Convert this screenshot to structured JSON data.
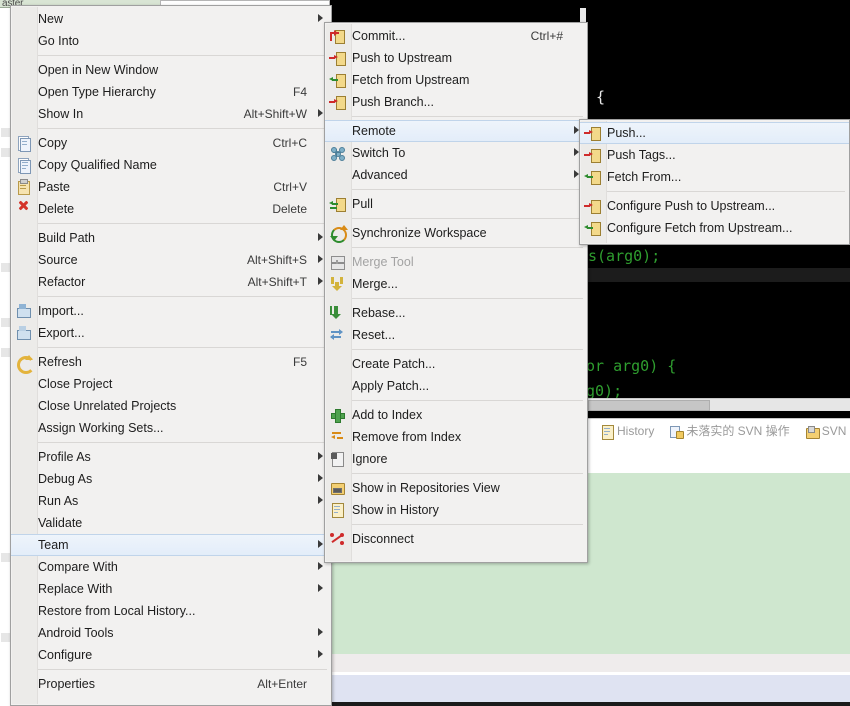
{
  "app": {
    "background_label": "aster",
    "editor_code_lines": [
      {
        "text": "{",
        "color": "white"
      },
      {
        "text": "s(arg0);",
        "color": "green"
      },
      {
        "text": "or arg0) {",
        "color": "mixed"
      },
      {
        "text": "g0);",
        "color": "green"
      }
    ],
    "view_tabs": [
      {
        "icon": "history-icon",
        "label": "History"
      },
      {
        "icon": "svn-pending-icon",
        "label": "未落实的 SVN 操作"
      },
      {
        "icon": "svn-resource-icon",
        "label": "SVN 资"
      }
    ]
  },
  "context_menu": {
    "name": "project-context-menu",
    "items": [
      {
        "label": "New",
        "icon": "",
        "accel": "",
        "submenu": true
      },
      {
        "label": "Go Into",
        "icon": "",
        "accel": "",
        "submenu": false
      },
      {
        "separator": true
      },
      {
        "label": "Open in New Window",
        "icon": "",
        "accel": "",
        "submenu": false
      },
      {
        "label": "Open Type Hierarchy",
        "icon": "",
        "accel": "F4",
        "submenu": false
      },
      {
        "label": "Show In",
        "icon": "",
        "accel": "Alt+Shift+W",
        "submenu": true
      },
      {
        "separator": true
      },
      {
        "label": "Copy",
        "icon": "copy-icon",
        "accel": "Ctrl+C",
        "submenu": false
      },
      {
        "label": "Copy Qualified Name",
        "icon": "copy-qualified-icon",
        "accel": "",
        "submenu": false
      },
      {
        "label": "Paste",
        "icon": "paste-icon",
        "accel": "Ctrl+V",
        "submenu": false
      },
      {
        "label": "Delete",
        "icon": "delete-icon",
        "accel": "Delete",
        "submenu": false
      },
      {
        "separator": true
      },
      {
        "label": "Build Path",
        "icon": "",
        "accel": "",
        "submenu": true
      },
      {
        "label": "Source",
        "icon": "",
        "accel": "Alt+Shift+S",
        "submenu": true
      },
      {
        "label": "Refactor",
        "icon": "",
        "accel": "Alt+Shift+T",
        "submenu": true
      },
      {
        "separator": true
      },
      {
        "label": "Import...",
        "icon": "import-icon",
        "accel": "",
        "submenu": false
      },
      {
        "label": "Export...",
        "icon": "export-icon",
        "accel": "",
        "submenu": false
      },
      {
        "separator": true
      },
      {
        "label": "Refresh",
        "icon": "refresh-icon",
        "accel": "F5",
        "submenu": false
      },
      {
        "label": "Close Project",
        "icon": "",
        "accel": "",
        "submenu": false
      },
      {
        "label": "Close Unrelated Projects",
        "icon": "",
        "accel": "",
        "submenu": false
      },
      {
        "label": "Assign Working Sets...",
        "icon": "",
        "accel": "",
        "submenu": false
      },
      {
        "separator": true
      },
      {
        "label": "Profile As",
        "icon": "",
        "accel": "",
        "submenu": true
      },
      {
        "label": "Debug As",
        "icon": "",
        "accel": "",
        "submenu": true
      },
      {
        "label": "Run As",
        "icon": "",
        "accel": "",
        "submenu": true
      },
      {
        "label": "Validate",
        "icon": "",
        "accel": "",
        "submenu": false
      },
      {
        "label": "Team",
        "icon": "",
        "accel": "",
        "submenu": true,
        "selected": true
      },
      {
        "label": "Compare With",
        "icon": "",
        "accel": "",
        "submenu": true
      },
      {
        "label": "Replace With",
        "icon": "",
        "accel": "",
        "submenu": true
      },
      {
        "label": "Restore from Local History...",
        "icon": "",
        "accel": "",
        "submenu": false
      },
      {
        "label": "Android Tools",
        "icon": "",
        "accel": "",
        "submenu": true
      },
      {
        "label": "Configure",
        "icon": "",
        "accel": "",
        "submenu": true
      },
      {
        "separator": true
      },
      {
        "label": "Properties",
        "icon": "",
        "accel": "Alt+Enter",
        "submenu": false
      }
    ]
  },
  "team_menu": {
    "name": "team-submenu",
    "items": [
      {
        "label": "Commit...",
        "icon": "commit-icon",
        "accel": "Ctrl+#",
        "submenu": false
      },
      {
        "label": "Push to Upstream",
        "icon": "push-upstream-icon",
        "accel": "",
        "submenu": false
      },
      {
        "label": "Fetch from Upstream",
        "icon": "fetch-upstream-icon",
        "accel": "",
        "submenu": false
      },
      {
        "label": "Push Branch...",
        "icon": "push-branch-icon",
        "accel": "",
        "submenu": false
      },
      {
        "separator": true
      },
      {
        "label": "Remote",
        "icon": "",
        "accel": "",
        "submenu": true,
        "selected": true
      },
      {
        "label": "Switch To",
        "icon": "switch-to-icon",
        "accel": "",
        "submenu": true
      },
      {
        "label": "Advanced",
        "icon": "",
        "accel": "",
        "submenu": true
      },
      {
        "separator": true
      },
      {
        "label": "Pull",
        "icon": "pull-icon",
        "accel": "",
        "submenu": false
      },
      {
        "separator": true
      },
      {
        "label": "Synchronize Workspace",
        "icon": "synchronize-icon",
        "accel": "",
        "submenu": false
      },
      {
        "separator": true
      },
      {
        "label": "Merge Tool",
        "icon": "merge-tool-icon",
        "accel": "",
        "submenu": false,
        "disabled": true
      },
      {
        "label": "Merge...",
        "icon": "merge-icon",
        "accel": "",
        "submenu": false
      },
      {
        "separator": true
      },
      {
        "label": "Rebase...",
        "icon": "rebase-icon",
        "accel": "",
        "submenu": false
      },
      {
        "label": "Reset...",
        "icon": "reset-icon",
        "accel": "",
        "submenu": false
      },
      {
        "separator": true
      },
      {
        "label": "Create Patch...",
        "icon": "",
        "accel": "",
        "submenu": false
      },
      {
        "label": "Apply Patch...",
        "icon": "",
        "accel": "",
        "submenu": false
      },
      {
        "separator": true
      },
      {
        "label": "Add to Index",
        "icon": "add-to-index-icon",
        "accel": "",
        "submenu": false
      },
      {
        "label": "Remove from Index",
        "icon": "remove-from-index-icon",
        "accel": "",
        "submenu": false
      },
      {
        "label": "Ignore",
        "icon": "ignore-icon",
        "accel": "",
        "submenu": false
      },
      {
        "separator": true
      },
      {
        "label": "Show in Repositories View",
        "icon": "repositories-view-icon",
        "accel": "",
        "submenu": false
      },
      {
        "label": "Show in History",
        "icon": "history-icon",
        "accel": "",
        "submenu": false
      },
      {
        "separator": true
      },
      {
        "label": "Disconnect",
        "icon": "disconnect-icon",
        "accel": "",
        "submenu": false
      }
    ]
  },
  "remote_menu": {
    "name": "remote-submenu",
    "items": [
      {
        "label": "Push...",
        "icon": "push-icon",
        "accel": "",
        "submenu": false,
        "selected": true
      },
      {
        "label": "Push Tags...",
        "icon": "push-tags-icon",
        "accel": "",
        "submenu": false
      },
      {
        "label": "Fetch From...",
        "icon": "fetch-from-icon",
        "accel": "",
        "submenu": false
      },
      {
        "separator": true
      },
      {
        "label": "Configure Push to Upstream...",
        "icon": "configure-push-icon",
        "accel": "",
        "submenu": false
      },
      {
        "label": "Configure Fetch from Upstream...",
        "icon": "configure-fetch-icon",
        "accel": "",
        "submenu": false
      }
    ]
  },
  "colors": {
    "menu_bg": "#f2f1f0",
    "menu_border": "#a0a0a0",
    "selection": "#e3edf9",
    "selection_border": "#c0d4ea",
    "editor_bg": "#000000",
    "code_green": "#2f9e2f",
    "panel_green": "#cfe7cf",
    "panel_lavender": "#dfe3f2"
  }
}
